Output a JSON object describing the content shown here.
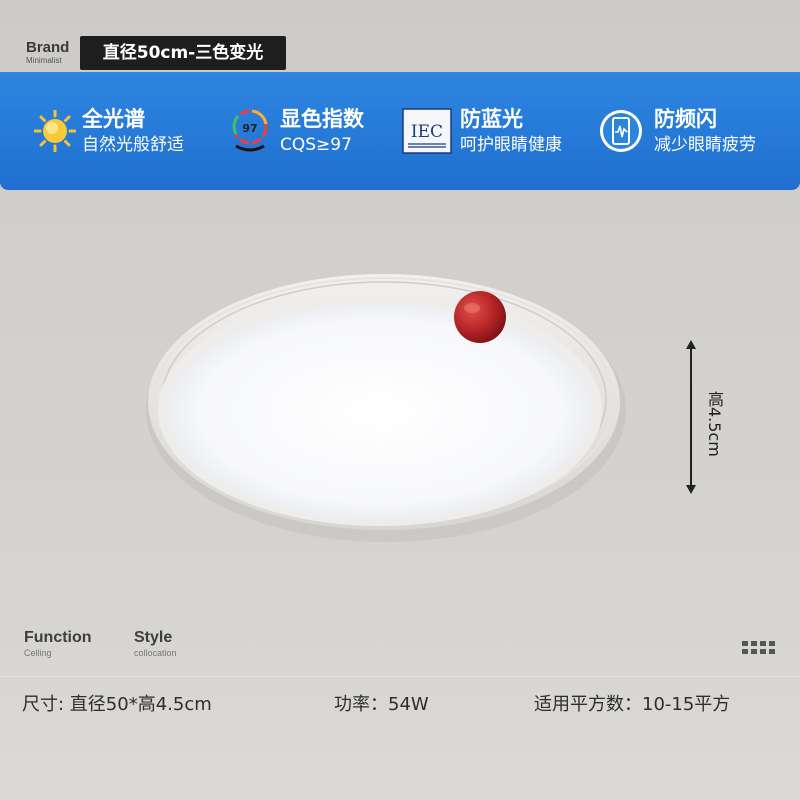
{
  "brand": {
    "name": "Brand",
    "tagline": "Minimalist"
  },
  "title": "直径50cm-三色变光",
  "features": [
    {
      "icon": "sun-icon",
      "title": "全光谱",
      "subtitle": "自然光般舒适"
    },
    {
      "icon": "color-index-dial-icon",
      "badge": "97",
      "title": "显色指数",
      "subtitle": "CQS≥97"
    },
    {
      "icon": "iec-logo-icon",
      "badge": "IEC",
      "title": "防蓝光",
      "subtitle": "呵护眼睛健康"
    },
    {
      "icon": "anti-flicker-phone-icon",
      "title": "防频闪",
      "subtitle": "减少眼睛疲劳"
    }
  ],
  "dimension_label": "高4.5cm",
  "tabs": [
    {
      "label": "Function",
      "sub": "Celling"
    },
    {
      "label": "Style",
      "sub": "collocation"
    }
  ],
  "specs": {
    "size": "尺寸: 直径50*高4.5cm",
    "power": "功率：54W",
    "area": "适用平方数：10-15平方"
  },
  "colors": {
    "banner_blue": "#2479d8",
    "ceiling": "#d1cfcc",
    "knob_red": "#b8282a",
    "title_bg": "#1e1e1e"
  }
}
